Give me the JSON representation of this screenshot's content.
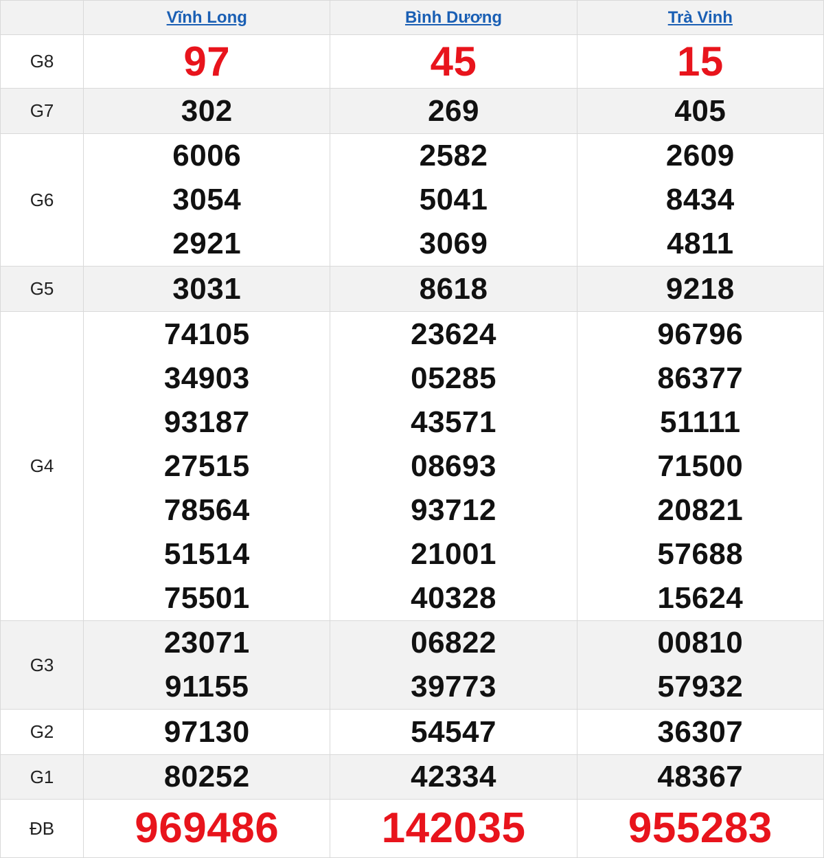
{
  "colors": {
    "accent_red": "#e8141c",
    "link_blue": "#1a5fb4",
    "shade": "#f2f2f2"
  },
  "provinces": [
    "Vĩnh Long",
    "Bình Dương",
    "Trà Vinh"
  ],
  "prizes": [
    {
      "name": "G8",
      "red": true,
      "shaded": false,
      "values": [
        [
          "97"
        ],
        [
          "45"
        ],
        [
          "15"
        ]
      ]
    },
    {
      "name": "G7",
      "red": false,
      "shaded": true,
      "values": [
        [
          "302"
        ],
        [
          "269"
        ],
        [
          "405"
        ]
      ]
    },
    {
      "name": "G6",
      "red": false,
      "shaded": false,
      "values": [
        [
          "6006",
          "3054",
          "2921"
        ],
        [
          "2582",
          "5041",
          "3069"
        ],
        [
          "2609",
          "8434",
          "4811"
        ]
      ]
    },
    {
      "name": "G5",
      "red": false,
      "shaded": true,
      "values": [
        [
          "3031"
        ],
        [
          "8618"
        ],
        [
          "9218"
        ]
      ]
    },
    {
      "name": "G4",
      "red": false,
      "shaded": false,
      "values": [
        [
          "74105",
          "34903",
          "93187",
          "27515",
          "78564",
          "51514",
          "75501"
        ],
        [
          "23624",
          "05285",
          "43571",
          "08693",
          "93712",
          "21001",
          "40328"
        ],
        [
          "96796",
          "86377",
          "51111",
          "71500",
          "20821",
          "57688",
          "15624"
        ]
      ]
    },
    {
      "name": "G3",
      "red": false,
      "shaded": true,
      "values": [
        [
          "23071",
          "91155"
        ],
        [
          "06822",
          "39773"
        ],
        [
          "00810",
          "57932"
        ]
      ]
    },
    {
      "name": "G2",
      "red": false,
      "shaded": false,
      "values": [
        [
          "97130"
        ],
        [
          "54547"
        ],
        [
          "36307"
        ]
      ]
    },
    {
      "name": "G1",
      "red": false,
      "shaded": true,
      "values": [
        [
          "80252"
        ],
        [
          "42334"
        ],
        [
          "48367"
        ]
      ]
    },
    {
      "name": "ĐB",
      "red": true,
      "shaded": false,
      "values": [
        [
          "969486"
        ],
        [
          "142035"
        ],
        [
          "955283"
        ]
      ]
    }
  ]
}
